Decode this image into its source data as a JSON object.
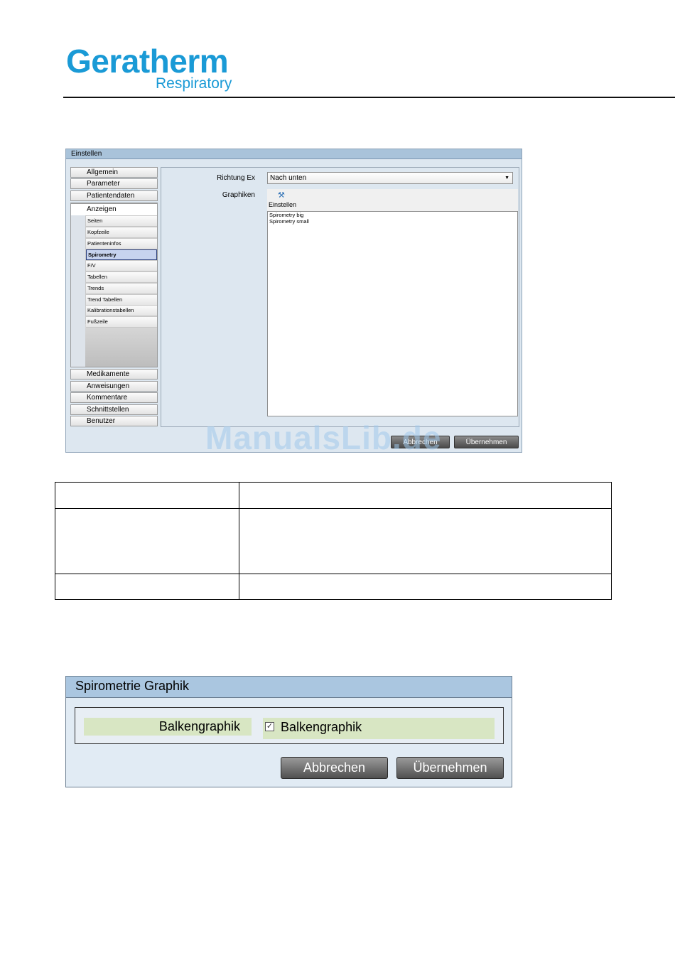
{
  "header": {
    "logo_main": "Geratherm",
    "logo_sub": "Respiratory"
  },
  "settings_window": {
    "title": "Einstellen",
    "nav_top": [
      "Allgemein",
      "Parameter",
      "Patientendaten"
    ],
    "nav_open": "Anzeigen",
    "nav_sub": [
      "Seiten",
      "Kopfzeile",
      "Patienteninfos",
      "Spirometry",
      "F/V",
      "Tabellen",
      "Trends",
      "Trend Tabellen",
      "Kalibrationstabellen",
      "Fußzeile"
    ],
    "nav_sub_selected": "Spirometry",
    "nav_bottom": [
      "Medikamente",
      "Anweisungen",
      "Kommentare",
      "Schnittstellen",
      "Benutzer"
    ],
    "richtung_label": "Richtung Ex",
    "richtung_value": "Nach unten",
    "graphiken_label": "Graphiken",
    "toolbar_label": "Einstellen",
    "wrench_icon": "wrench-icon",
    "graph_items": [
      "Spirometry big",
      "Spirometry small"
    ],
    "cancel_label": "Abbrechen",
    "apply_label": "Übernehmen"
  },
  "watermark": "ManualsLib.de",
  "spiro_dialog": {
    "title": "Spirometrie Graphik",
    "field_label": "Balkengraphik",
    "checkbox_label": "Balkengraphik",
    "checkbox_checked": true,
    "cancel_label": "Abbrechen",
    "apply_label": "Übernehmen"
  }
}
